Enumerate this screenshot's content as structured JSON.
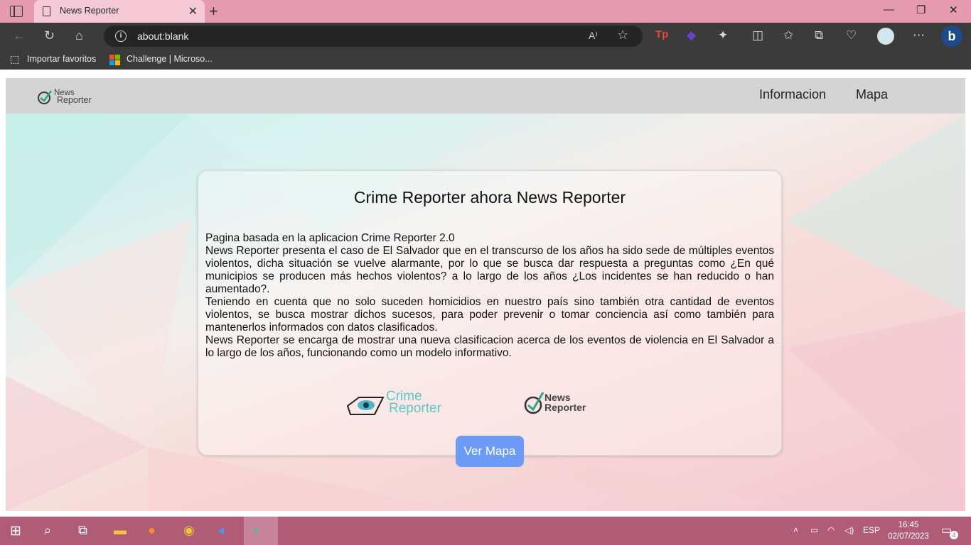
{
  "browser": {
    "tab_title": "News Reporter",
    "tab_close": "✕",
    "new_tab": "+",
    "url": "about:blank",
    "bookmarks": [
      "Importar favoritos",
      "Challenge | Microso..."
    ],
    "window_controls": [
      "—",
      "❐",
      "✕"
    ],
    "colors": {
      "tabbar": "#e69ab0",
      "toolbar": "#3b3b3b"
    }
  },
  "site": {
    "logo_line1": "News",
    "logo_line2": "Reporter",
    "nav": [
      "Informacion",
      "Mapa"
    ]
  },
  "card": {
    "title": "Crime Reporter ahora News Reporter",
    "paragraphs": [
      "Pagina basada en la aplicacion Crime Reporter 2.0",
      "News Reporter presenta el caso de El Salvador que en el transcurso de los años ha sido sede de múltiples eventos violentos, dicha situación se vuelve alarmante, por lo que se busca dar respuesta a preguntas como ¿En qué municipios se producen más hechos violentos? a lo largo de los años ¿Los incidentes se han reducido o han aumentado?.",
      "Teniendo en cuenta que no solo suceden homicidios en nuestro país sino también otra cantidad de eventos violentos, se busca mostrar dichos sucesos, para poder prevenir o tomar conciencia así como también para mantenerlos informados con datos clasificados.",
      "News Reporter se encarga de mostrar una nueva clasificacion acerca de los eventos de violencia en El Salvador a lo largo de los años, funcionando como un modelo informativo."
    ],
    "crime_logo_line1": "Crime",
    "crime_logo_line2": "Reporter",
    "news_logo_line1": "News",
    "news_logo_line2": "Reporter",
    "button": "Ver Mapa",
    "button_color": "#6b9bf7"
  },
  "taskbar": {
    "language": "ESP",
    "time": "16:45",
    "date": "02/07/2023",
    "notifications": "4",
    "color": "#b05c77"
  }
}
